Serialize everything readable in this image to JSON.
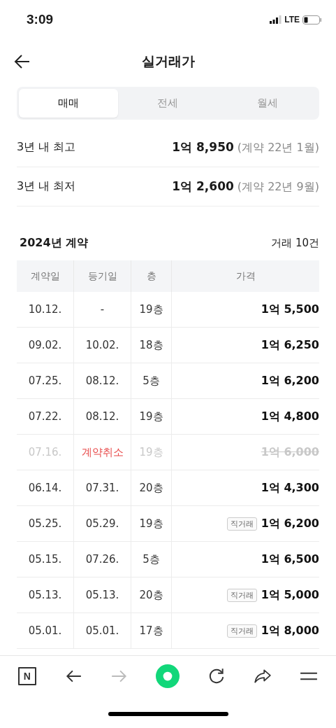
{
  "status_bar": {
    "time": "3:09",
    "network": "LTE"
  },
  "header": {
    "title": "실거래가"
  },
  "tabs": [
    {
      "label": "매매",
      "selected": true
    },
    {
      "label": "전세",
      "selected": false
    },
    {
      "label": "월세",
      "selected": false
    }
  ],
  "summary": [
    {
      "label": "3년 내 최고",
      "price": "1억 8,950",
      "note": "(계약 22년 1월)"
    },
    {
      "label": "3년 내 최저",
      "price": "1억 2,600",
      "note": "(계약 22년 9월)"
    }
  ],
  "section": {
    "title": "2024년 계약",
    "count": "거래 10건"
  },
  "table": {
    "columns": [
      "계약일",
      "등기일",
      "층",
      "가격"
    ],
    "rows": [
      {
        "contract": "10.12.",
        "registered": "-",
        "floor": "19층",
        "price": "1억 5,500",
        "cancelled": false
      },
      {
        "contract": "09.02.",
        "registered": "10.02.",
        "floor": "18층",
        "price": "1억 6,250",
        "cancelled": false
      },
      {
        "contract": "07.25.",
        "registered": "08.12.",
        "floor": "5층",
        "price": "1억 6,200",
        "cancelled": false
      },
      {
        "contract": "07.22.",
        "registered": "08.12.",
        "floor": "19층",
        "price": "1억 4,800",
        "cancelled": false
      },
      {
        "contract": "07.16.",
        "registered": "계약취소",
        "floor": "19층",
        "price": "1억 6,000",
        "cancelled": true
      },
      {
        "contract": "06.14.",
        "registered": "07.31.",
        "floor": "20층",
        "price": "1억 4,300",
        "cancelled": false
      },
      {
        "contract": "05.25.",
        "registered": "05.29.",
        "floor": "19층",
        "badge": "직거래",
        "price": "1억 6,200",
        "cancelled": false
      },
      {
        "contract": "05.15.",
        "registered": "07.26.",
        "floor": "5층",
        "price": "1억 6,500",
        "cancelled": false
      },
      {
        "contract": "05.13.",
        "registered": "05.13.",
        "floor": "20층",
        "badge": "직거래",
        "price": "1억 5,000",
        "cancelled": false
      },
      {
        "contract": "05.01.",
        "registered": "05.01.",
        "floor": "17층",
        "badge": "직거래",
        "price": "1억 8,000",
        "cancelled": false
      }
    ]
  },
  "toolbar": [
    {
      "kind": "logo",
      "text": "N",
      "disabled": false
    },
    {
      "kind": "back",
      "disabled": false
    },
    {
      "kind": "forward",
      "disabled": true
    },
    {
      "kind": "home",
      "disabled": false
    },
    {
      "kind": "reload",
      "disabled": false
    },
    {
      "kind": "share",
      "disabled": false
    },
    {
      "kind": "menu",
      "disabled": false
    }
  ]
}
